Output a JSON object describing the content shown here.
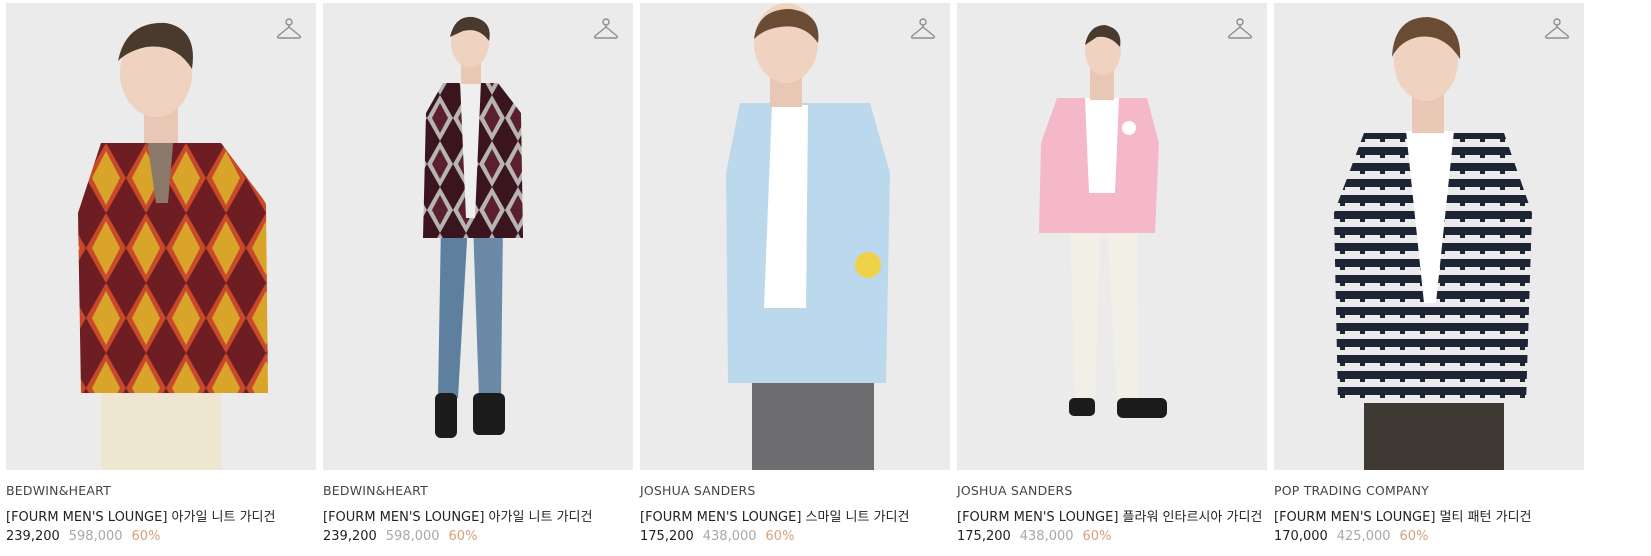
{
  "icons": {
    "wishlist": "hanger-icon"
  },
  "colors": {
    "discount": "#d9a07a",
    "original_price": "#a8a8a8",
    "photo_bg": "#ebebeb"
  },
  "products": [
    {
      "brand": "BEDWIN&HEART",
      "name": "[FOURM MEN'S LOUNGE] 아가일 니트 가디건",
      "sale_price": "239,200",
      "original_price": "598,000",
      "discount": "60%"
    },
    {
      "brand": "BEDWIN&HEART",
      "name": "[FOURM MEN'S LOUNGE] 아가일 니트 가디건",
      "sale_price": "239,200",
      "original_price": "598,000",
      "discount": "60%"
    },
    {
      "brand": "JOSHUA SANDERS",
      "name": "[FOURM MEN'S LOUNGE] 스마일 니트 가디건",
      "sale_price": "175,200",
      "original_price": "438,000",
      "discount": "60%"
    },
    {
      "brand": "JOSHUA SANDERS",
      "name": "[FOURM MEN'S LOUNGE] 플라워 인타르시아 가디건",
      "sale_price": "175,200",
      "original_price": "438,000",
      "discount": "60%"
    },
    {
      "brand": "POP TRADING COMPANY",
      "name": "[FOURM MEN'S LOUNGE] 멀티 패턴 가디건",
      "sale_price": "170,000",
      "original_price": "425,000",
      "discount": "60%"
    }
  ]
}
